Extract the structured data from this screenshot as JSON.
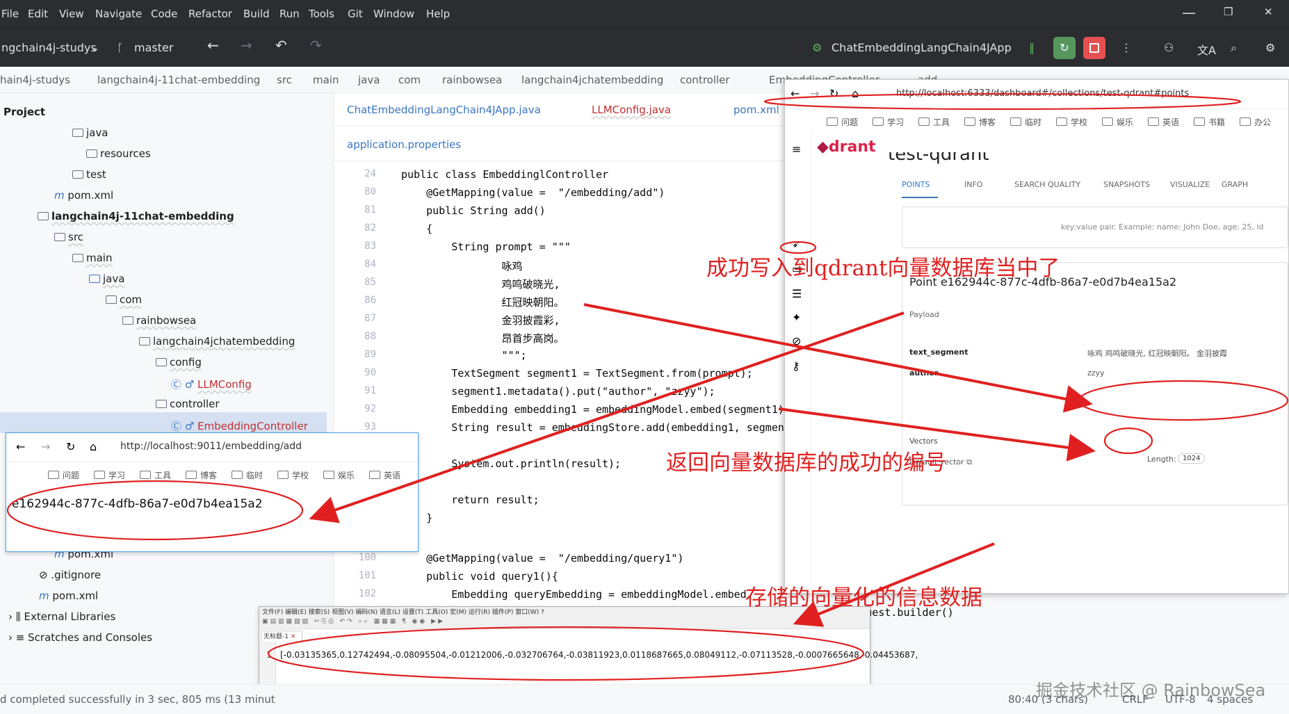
{
  "menu": [
    "File",
    "Edit",
    "View",
    "Navigate",
    "Code",
    "Refactor",
    "Build",
    "Run",
    "Tools",
    "Git",
    "Window",
    "Help"
  ],
  "toolbar": {
    "project": "ngchain4j-studys",
    "branch": "master",
    "run_config": "ChatEmbeddingLangChain4JApp"
  },
  "breadcrumbs": [
    "hain4j-studys",
    "langchain4j-11chat-embedding",
    "src",
    "main",
    "java",
    "com",
    "rainbowsea",
    "langchain4jchatembedding",
    "controller",
    "EmbeddingController",
    "add"
  ],
  "project_panel": {
    "title": "Project",
    "items": [
      "java",
      "resources",
      "test",
      "pom.xml",
      "langchain4j-11chat-embedding",
      "src",
      "main",
      "java",
      "com",
      "rainbowsea",
      "langchain4jchatembedding",
      "config",
      "LLMConfig",
      "controller",
      "EmbeddingController",
      "pom.xml",
      ".gitignore",
      "pom.xml",
      "External Libraries",
      "Scratches and Consoles"
    ]
  },
  "editor_tabs": [
    "ChatEmbeddingLangChain4JApp.java",
    "LLMConfig.java",
    "pom.xml",
    "application.properties"
  ],
  "code_lines": [
    {
      "n": "24",
      "t": "public class EmbeddinglController"
    },
    {
      "n": "80",
      "t": "    @GetMapping(value =  \"/embedding/add\")"
    },
    {
      "n": "81",
      "t": "    public String add()"
    },
    {
      "n": "82",
      "t": "    {"
    },
    {
      "n": "83",
      "t": "        String prompt = \"\"\""
    },
    {
      "n": "84",
      "t": "                咏鸡"
    },
    {
      "n": "85",
      "t": "                鸡鸣破晓光,"
    },
    {
      "n": "86",
      "t": "                红冠映朝阳。"
    },
    {
      "n": "87",
      "t": "                金羽披霞彩,"
    },
    {
      "n": "88",
      "t": "                昂首步高岗。"
    },
    {
      "n": "89",
      "t": "                \"\"\";"
    },
    {
      "n": "90",
      "t": "        TextSegment segment1 = TextSegment.from(prompt);"
    },
    {
      "n": "91",
      "t": "        segment1.metadata().put(\"author\", \"zzyy\");"
    },
    {
      "n": "92",
      "t": "        Embedding embedding1 = embeddingModel.embed(segment1)"
    },
    {
      "n": "93",
      "t": "        String result = embeddingStore.add(embedding1, segmen"
    },
    {
      "n": "",
      "t": ""
    },
    {
      "n": "",
      "t": "        System.out.println(result);"
    },
    {
      "n": "",
      "t": ""
    },
    {
      "n": "",
      "t": "        return result;"
    },
    {
      "n": "",
      "t": "    }"
    },
    {
      "n": "100",
      "t": "    @GetMapping(value =  \"/embedding/query1\")"
    },
    {
      "n": "101",
      "t": "    public void query1(){"
    },
    {
      "n": "102",
      "t": "        Embedding queryEmbedding = embeddingModel.embed"
    },
    {
      "n": "103",
      "t": "        EmbeddingSearchRequest embeddingSearchRequest = EmbeddingSearchRequest.builder()"
    }
  ],
  "browser_small": {
    "url": "http://localhost:9011/embedding/add",
    "bookmarks": [
      "问题",
      "学习",
      "工具",
      "博客",
      "临时",
      "学校",
      "娱乐",
      "英语"
    ],
    "result": "e162944c-877c-4dfb-86a7-e0d7b4ea15a2"
  },
  "qdrant": {
    "url": "http://localhost:6333/dashboard#/collections/test-qdrant#points",
    "bookmarks": [
      "问题",
      "学习",
      "工具",
      "博客",
      "临时",
      "学校",
      "娱乐",
      "英语",
      "书籍",
      "办公"
    ],
    "logo": "drant",
    "collection": "test-qdrant",
    "tabs": [
      "POINTS",
      "INFO",
      "SEARCH QUALITY",
      "SNAPSHOTS",
      "VISUALIZE",
      "GRAPH"
    ],
    "filter_placeholder": "key:value pair. Example: name: John Doe, age: 25, id",
    "point_title": "Point e162944c-877c-4dfb-86a7-e0d7b4ea15a2",
    "payload_label": "Payload",
    "text_segment_key": "text_segment",
    "text_segment_val": "咏鸡 鸡鸣破晓光, 红冠映朝阳。 金羽披霞",
    "author_key": "author",
    "author_val": "zzyy",
    "vectors_label": "Vectors",
    "default_vector": "Default vector",
    "length_label": "Length:",
    "length_val": "1024"
  },
  "notepad": {
    "menu": "文件(F)  编辑(E)  搜索(S)  视图(V)  编码(N)  语言(L)  设置(T)  工具(O)  宏(M)  运行(R)  插件(P)  窗口(W)  ?",
    "tab": "无标题-1",
    "line_no": "1",
    "line": "[-0.03135365,0.12742494,-0.08095504,-0.01212006,-0.032706764,-0.03811923,0.0118687665,0.08049112,-0.07113528,-0.0007665648,-0.04453687,"
  },
  "annotations": {
    "a1": "成功写入到qdrant向量数据库当中了",
    "a2": "返回向量数据库的成功的编号",
    "a3": "存储的向量化的信息数据"
  },
  "status": {
    "left": "d completed successfully in 3 sec, 805 ms (13 minut",
    "position": "80:40 (3 chars)",
    "eol": "CRLF",
    "enc": "UTF-8",
    "indent": "4 spaces",
    "watermark": "掘金技术社区 @ RainbowSea"
  },
  "colors": {
    "accent": "#e02020",
    "ide_dark": "#2b2d30",
    "link": "#3b76c2"
  }
}
